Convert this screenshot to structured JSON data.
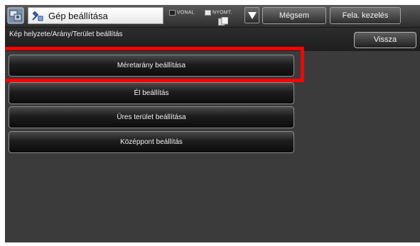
{
  "header": {
    "title": "Gép beállítása",
    "app_icon": "settings-icon",
    "title_icon": "machine-settings-icon",
    "indicator_line_label": "VONAL",
    "indicator_print_label": "NYOMT.",
    "job_icon": "job-status-icon",
    "dropdown_icon": "triangle-down-icon",
    "cancel_label": "Mégsem",
    "release_label": "Fela. kezelés"
  },
  "breadcrumb": {
    "text": "Kép helyzete/Arány/Terület beállítás",
    "back_label": "Vissza"
  },
  "menu": {
    "items": [
      {
        "label": "Méretarány beállítása",
        "highlighted": true
      },
      {
        "label": "Él beállítás"
      },
      {
        "label": "Üres terület beállítása"
      },
      {
        "label": "Középpont beállítás"
      }
    ]
  },
  "colors": {
    "highlight": "#ff0000",
    "background": "#3b3b3b"
  }
}
